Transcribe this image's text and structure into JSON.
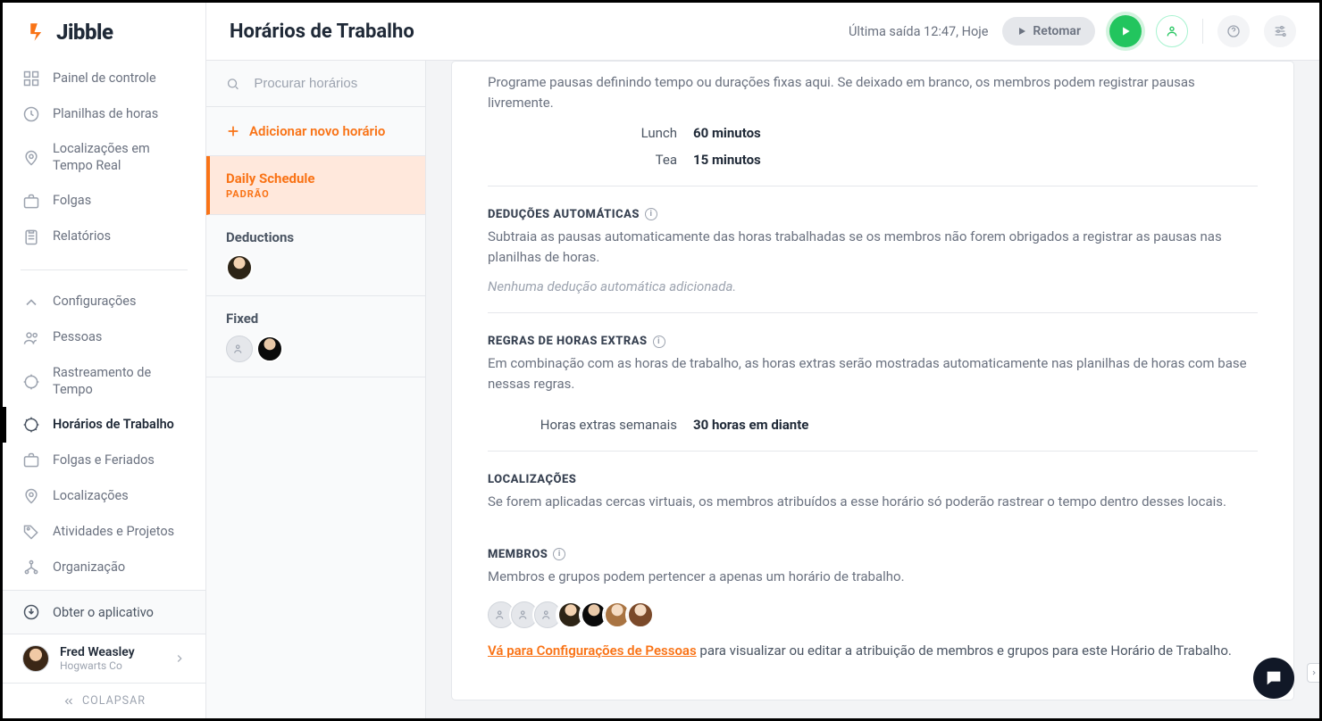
{
  "brand": {
    "name": "Jibble"
  },
  "header": {
    "title": "Horários de Trabalho",
    "last_exit": "Última saída 12:47, Hoje",
    "resume_label": "Retomar"
  },
  "sidebar": {
    "items": [
      {
        "label": "Painel de controle"
      },
      {
        "label": "Planilhas de horas"
      },
      {
        "label": "Localizações em Tempo Real"
      },
      {
        "label": "Folgas"
      },
      {
        "label": "Relatórios"
      }
    ],
    "settings_label": "Configurações",
    "settings_items": [
      {
        "label": "Pessoas"
      },
      {
        "label": "Rastreamento de Tempo"
      },
      {
        "label": "Horários de Trabalho"
      },
      {
        "label": "Folgas e Feriados"
      },
      {
        "label": "Localizações"
      },
      {
        "label": "Atividades e Projetos"
      },
      {
        "label": "Organização"
      }
    ],
    "get_app": "Obter o aplicativo",
    "user": {
      "name": "Fred Weasley",
      "org": "Hogwarts Co"
    },
    "collapse": "COLAPSAR"
  },
  "schedule_panel": {
    "search_placeholder": "Procurar horários",
    "add_label": "Adicionar novo horário",
    "items": [
      {
        "name": "Daily Schedule",
        "badge": "PADRÃO"
      },
      {
        "name": "Deductions"
      },
      {
        "name": "Fixed"
      }
    ]
  },
  "content": {
    "breaks_desc": "Programe pausas definindo tempo ou durações fixas aqui. Se deixado em branco, os membros podem registrar pausas livremente.",
    "breaks": [
      {
        "name": "Lunch",
        "value": "60 minutos"
      },
      {
        "name": "Tea",
        "value": "15 minutos"
      }
    ],
    "auto_deductions": {
      "title": "DEDUÇÕES AUTOMÁTICAS",
      "desc": "Subtraia as pausas automaticamente das horas trabalhadas se os membros não forem obrigados a registrar as pausas nas planilhas de horas.",
      "empty": "Nenhuma dedução automática adicionada."
    },
    "overtime": {
      "title": "REGRAS DE HORAS EXTRAS",
      "desc": "Em combinação com as horas de trabalho, as horas extras serão mostradas automaticamente nas planilhas de horas com base nessas regras.",
      "row": {
        "key": "Horas extras semanais",
        "value": "30 horas em diante"
      }
    },
    "locations": {
      "title": "LOCALIZAÇÕES",
      "desc": "Se forem aplicadas cercas virtuais, os membros atribuídos a esse horário só poderão rastrear o tempo dentro desses locais."
    },
    "members": {
      "title": "MEMBROS",
      "desc": "Membros e grupos podem pertencer a apenas um horário de trabalho.",
      "link": "Vá para Configurações de Pessoas",
      "tail": " para visualizar ou editar a atribuição de membros e grupos para este Horário de Trabalho."
    }
  }
}
